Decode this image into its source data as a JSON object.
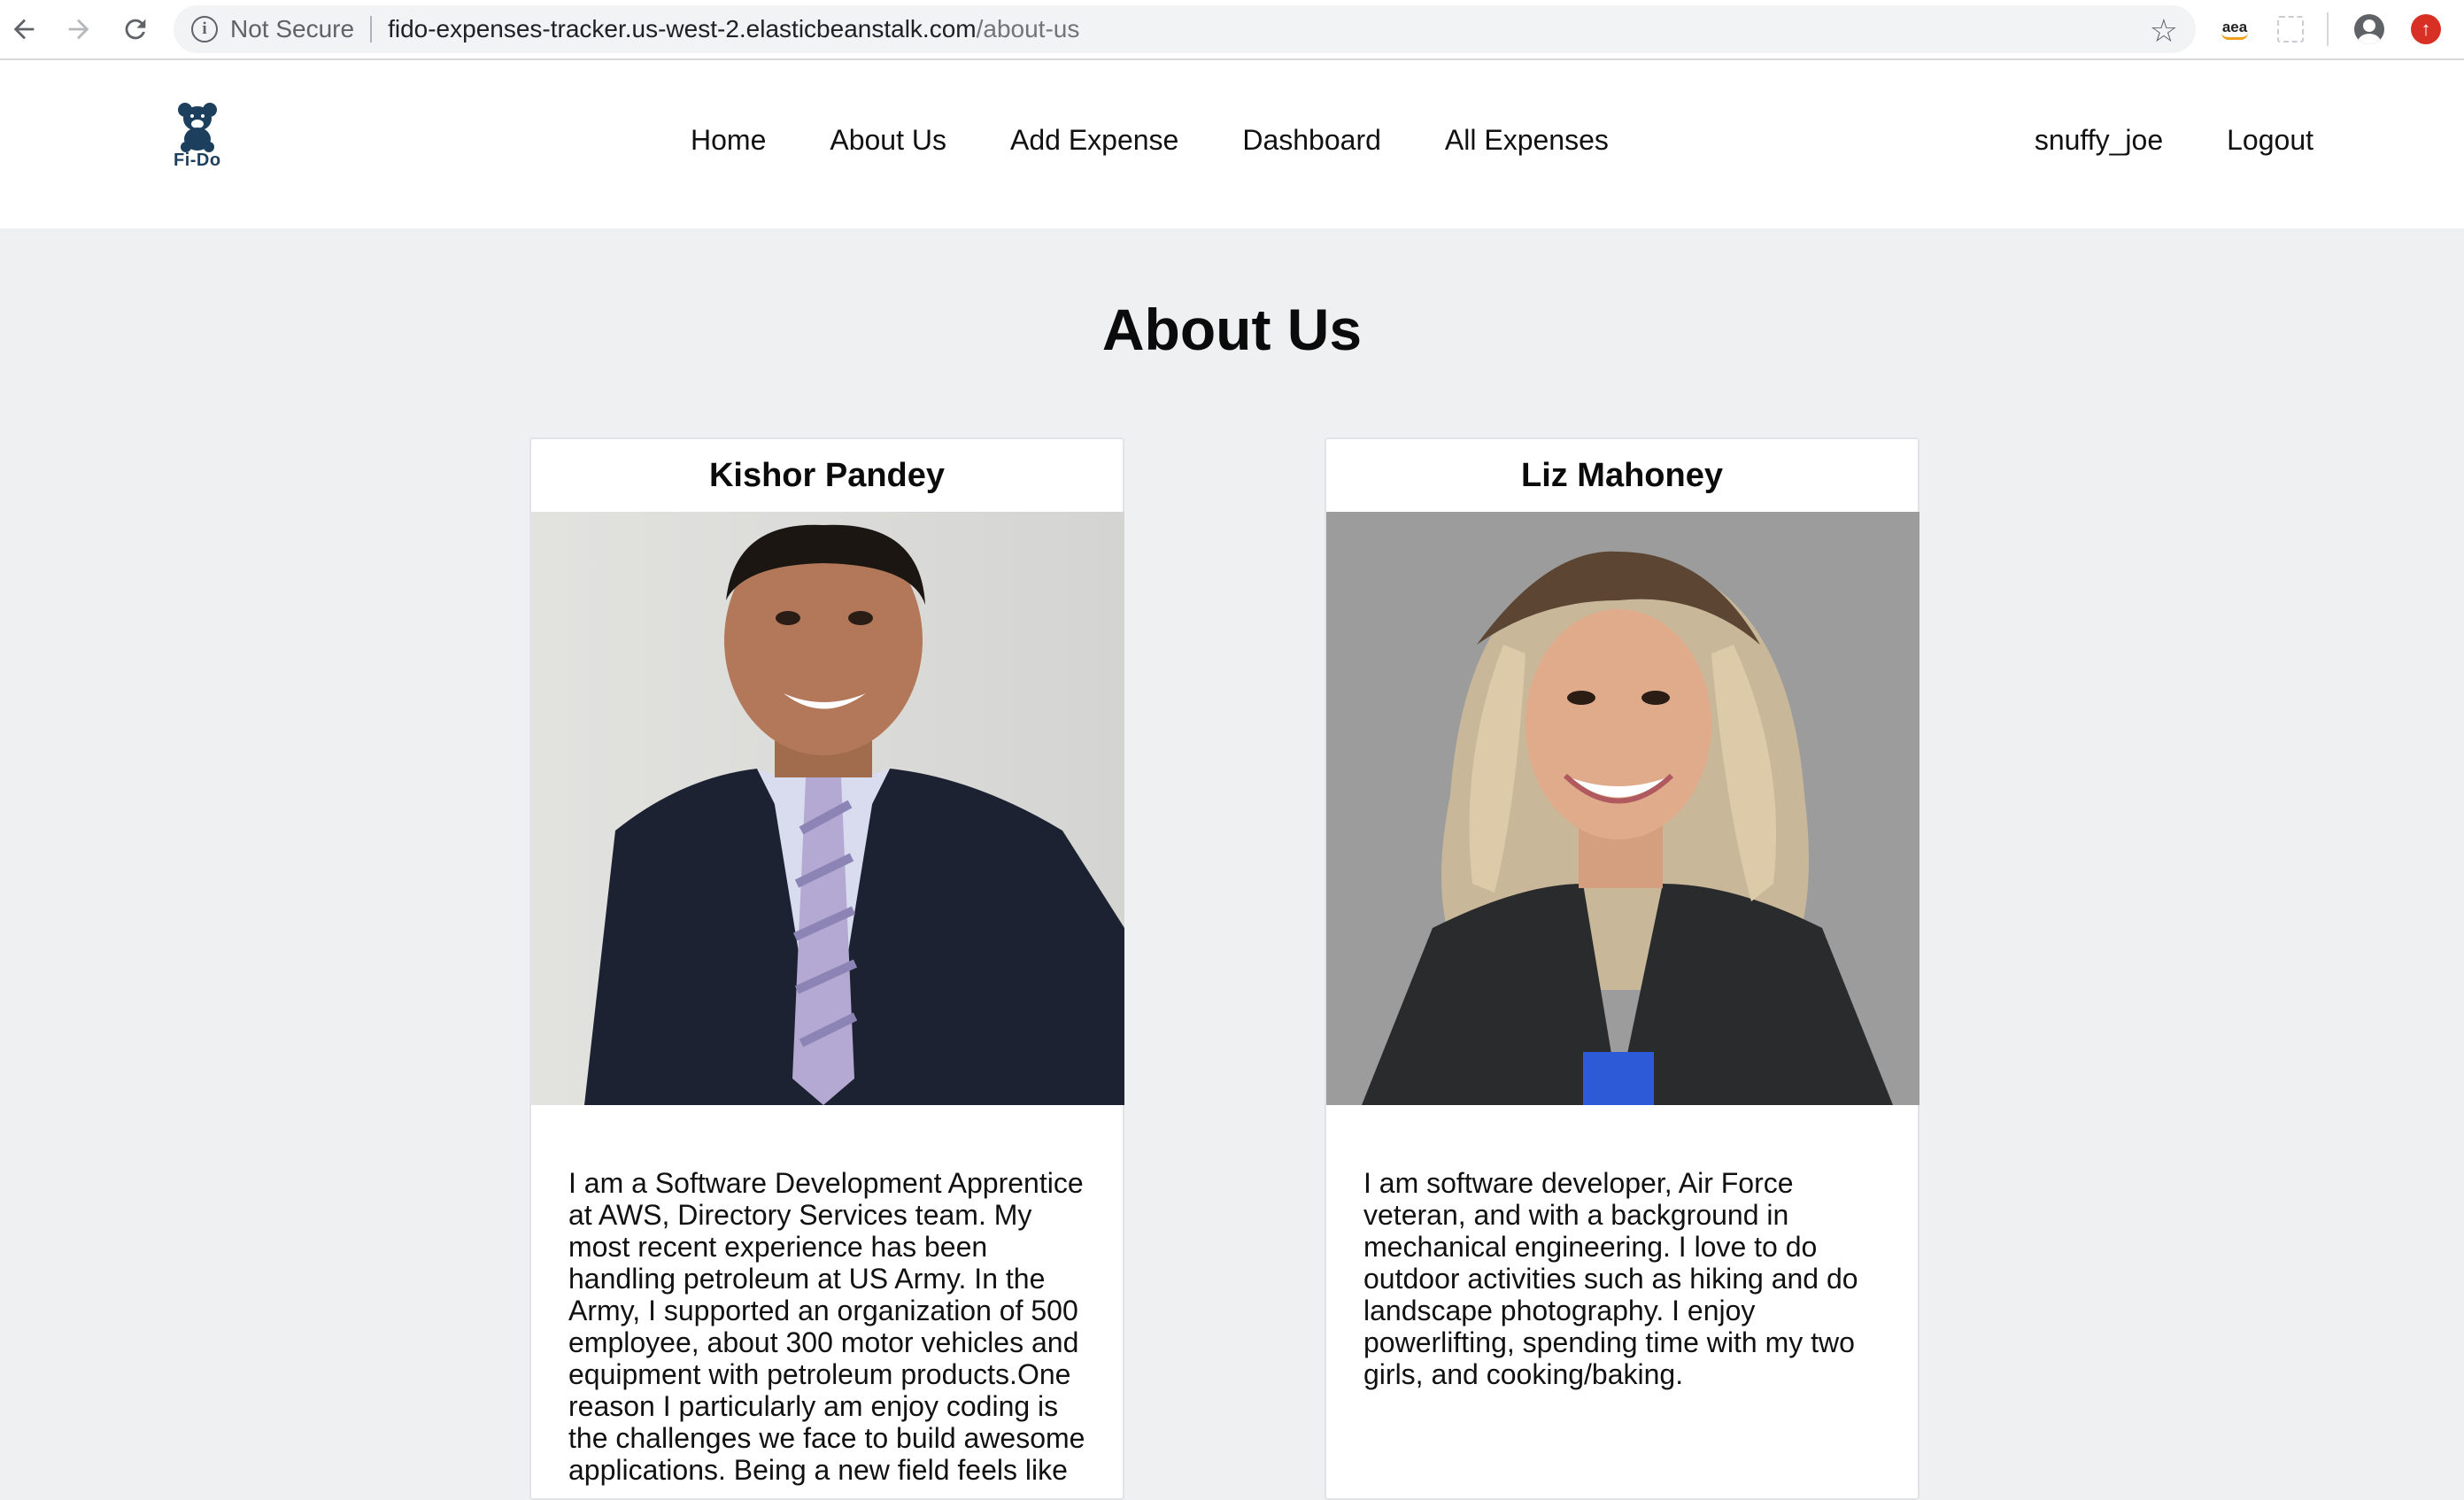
{
  "browser": {
    "security_label": "Not Secure",
    "url_host": "fido-expenses-tracker.us-west-2.elasticbeanstalk.com",
    "url_path": "/about-us",
    "extension_aea_label": "aea"
  },
  "navbar": {
    "logo_text": "Fi-Do",
    "links": [
      "Home",
      "About Us",
      "Add Expense",
      "Dashboard",
      "All Expenses"
    ],
    "username": "snuffy_joe",
    "logout_label": "Logout"
  },
  "page": {
    "title": "About Us",
    "members": [
      {
        "name": "Kishor Pandey",
        "bio": "I am a Software Development Apprentice at AWS, Directory Services team. My most recent experience has been handling petroleum at US Army. In the Army, I supported an organization of 500 employee, about 300 motor vehicles and equipment with petroleum products.One reason I particularly am enjoy coding is the challenges we face to build awesome applications. Being a new field feels like"
      },
      {
        "name": "Liz Mahoney",
        "bio": "I am software developer, Air Force veteran, and with a background in mechanical engineering. I love to do outdoor activities such as hiking and do landscape photography. I enjoy powerlifting, spending time with my two girls, and cooking/baking."
      }
    ]
  }
}
